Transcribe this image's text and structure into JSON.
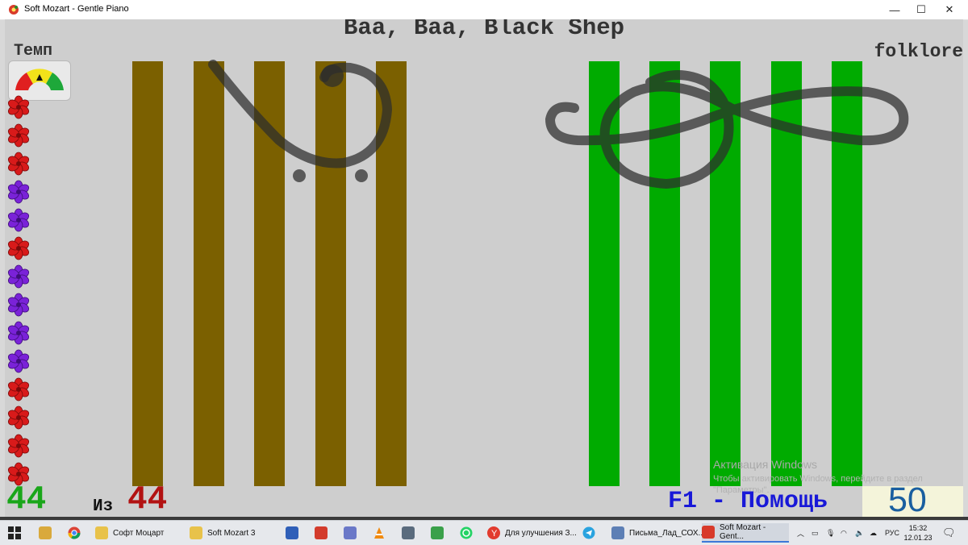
{
  "window": {
    "title": "Soft Mozart - Gentle Piano",
    "buttons": {
      "minimize": "—",
      "maximize": "☐",
      "close": "✕"
    }
  },
  "game": {
    "song_title": "Baa, Baa, Black Shep",
    "tempo_label": "Темп",
    "genre": "folklore",
    "counter_current": "44",
    "counter_of_label": "Из",
    "counter_total": "44",
    "help_label": "F1 - Помощь",
    "score": "50",
    "tempo_gauge_level": "medium",
    "flower_colors": [
      "red",
      "red",
      "red",
      "purple",
      "purple",
      "red",
      "purple",
      "purple",
      "purple",
      "purple",
      "red",
      "red",
      "red",
      "red"
    ],
    "left_staff_color": "#7b6000",
    "right_staff_color": "#00ab00"
  },
  "watermark": {
    "title": "Активация Windows",
    "subtitle": "Чтобы активировать Windows, перейдите в раздел \"Параметры\"."
  },
  "taskbar": {
    "items": [
      {
        "label": "Софт Моцарт",
        "icon": "folder-icon"
      },
      {
        "label": "Soft Mozart 3",
        "icon": "folder-icon"
      },
      {
        "label": "Для улучшения З...",
        "icon": "yandex-browser-icon"
      },
      {
        "label": "Письма_Лад_СОХ...",
        "icon": "document-icon"
      },
      {
        "label": "Soft Mozart - Gent...",
        "icon": "soft-mozart-icon"
      }
    ],
    "tray": {
      "language": "РУС",
      "time": "15:32",
      "date": "12.01.23"
    }
  }
}
